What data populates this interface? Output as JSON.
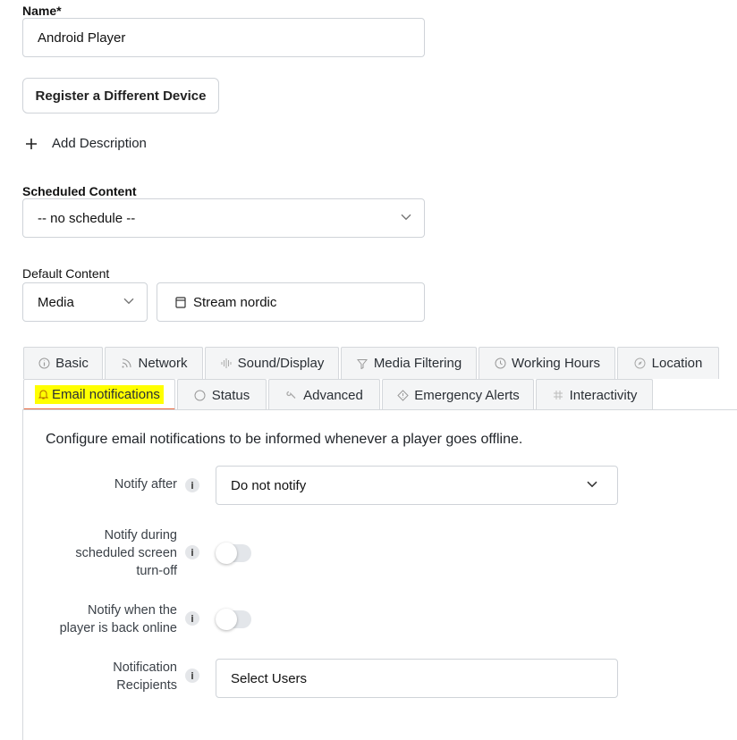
{
  "name_field": {
    "label": "Name*",
    "value": "Android Player"
  },
  "register_button": {
    "label": "Register a Different Device"
  },
  "add_description": {
    "label": "Add Description"
  },
  "scheduled_content": {
    "label": "Scheduled Content",
    "value": "-- no schedule --"
  },
  "default_content": {
    "label": "Default Content",
    "type_value": "Media",
    "media_value": "Stream nordic"
  },
  "tabs_row1": [
    {
      "label": "Basic",
      "icon": "info-circle-icon"
    },
    {
      "label": "Network",
      "icon": "wifi-icon"
    },
    {
      "label": "Sound/Display",
      "icon": "sound-wave-icon"
    },
    {
      "label": "Media Filtering",
      "icon": "filter-icon"
    },
    {
      "label": "Working Hours",
      "icon": "clock-icon"
    },
    {
      "label": "Location",
      "icon": "compass-icon"
    }
  ],
  "tabs_row2": [
    {
      "label": "Email notifications",
      "icon": "bell-icon",
      "active": true
    },
    {
      "label": "Status",
      "icon": "circle-icon"
    },
    {
      "label": "Advanced",
      "icon": "wrench-icon"
    },
    {
      "label": "Emergency Alerts",
      "icon": "diamond-alert-icon"
    },
    {
      "label": "Interactivity",
      "icon": "grid-icon"
    }
  ],
  "email_panel": {
    "description": "Configure email notifications to be informed whenever a player goes offline.",
    "notify_after": {
      "label": "Notify after",
      "value": "Do not notify"
    },
    "notify_during_turnoff": {
      "label_lines": [
        "Notify during",
        "scheduled screen",
        "turn-off"
      ],
      "enabled": false
    },
    "notify_back_online": {
      "label_lines": [
        "Notify when the",
        "player is back online"
      ],
      "enabled": false
    },
    "recipients": {
      "label_lines": [
        "Notification",
        "Recipients"
      ],
      "value": "Select Users"
    }
  },
  "colors": {
    "active_tab_underline": "#e8663d",
    "highlight": "#ffff00",
    "border": "#cfd3d8"
  }
}
